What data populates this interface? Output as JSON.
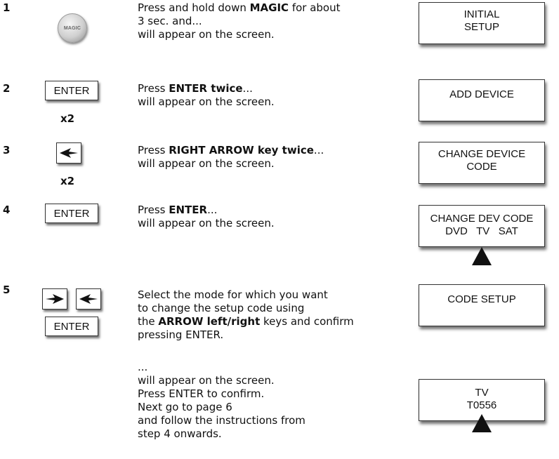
{
  "steps": [
    {
      "number": "1",
      "key_label": "MAGIC",
      "instruction": {
        "pre": "Press and hold down ",
        "bold": "MAGIC",
        "post": " for about",
        "line2": "3 sec. and...",
        "line3": "will appear on the screen."
      },
      "screen": [
        "INITIAL",
        "SETUP"
      ]
    },
    {
      "number": "2",
      "key_label": "ENTER",
      "multiplier": "x2",
      "instruction": {
        "pre": "Press ",
        "bold": "ENTER twice",
        "post": "...",
        "line2": "will appear on the screen."
      },
      "screen": [
        "ADD DEVICE"
      ]
    },
    {
      "number": "3",
      "multiplier": "x2",
      "instruction": {
        "pre": "Press ",
        "bold": "RIGHT ARROW key twice",
        "post": "...",
        "line2": "will appear on the screen."
      },
      "screen": [
        "CHANGE DEVICE",
        "CODE"
      ]
    },
    {
      "number": "4",
      "key_label": "ENTER",
      "instruction": {
        "pre": "Press ",
        "bold": "ENTER",
        "post": "...",
        "line2": "will appear on the screen."
      },
      "screen": [
        "CHANGE DEV CODE",
        "DVD   TV   SAT"
      ]
    },
    {
      "number": "5",
      "key_label": "ENTER",
      "instruction": {
        "line1": "Select the mode for which you want",
        "line2": "to change the setup code using",
        "pre": "the ",
        "bold": "ARROW left/right",
        "post": " keys and confirm",
        "line4": "pressing ENTER."
      },
      "screen": [
        "CODE SETUP"
      ]
    }
  ],
  "continuation": {
    "lines": [
      "...",
      "will appear on the screen.",
      "Press ENTER to confirm.",
      "Next go to page 6",
      "and follow the instructions from",
      "step 4 onwards."
    ],
    "screen": [
      "TV",
      "T0556"
    ]
  }
}
